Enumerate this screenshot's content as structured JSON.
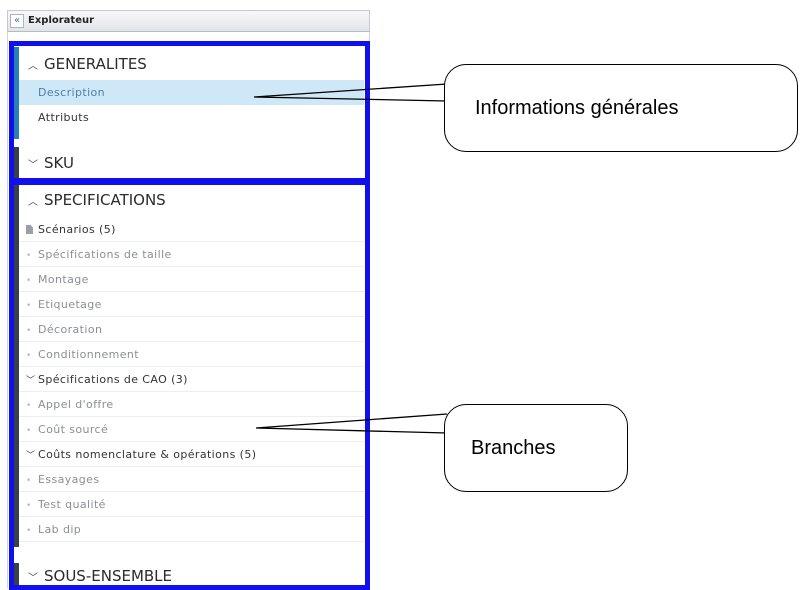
{
  "panel": {
    "title": "Explorateur",
    "collapse_glyph": "«"
  },
  "sections": {
    "generalites": {
      "title": "GENERALITES",
      "expanded": true,
      "accent": "#2a7fb4",
      "items": [
        "Description",
        "Attributs"
      ],
      "selected": "Description"
    },
    "sku": {
      "title": "SKU",
      "expanded": false,
      "accent": "#3a4048"
    },
    "specifications": {
      "title": "SPECIFICATIONS",
      "expanded": true,
      "accent": "#3a4048",
      "items": [
        "Scénarios (5)",
        "Spécifications de taille",
        "Montage",
        "Etiquetage",
        "Décoration",
        "Conditionnement",
        "Spécifications de CAO (3)",
        "Appel d'offre",
        "Coût sourcé",
        "Coûts nomenclature & opérations (5)",
        "Essayages",
        "Test qualité",
        "Lab dip"
      ]
    },
    "sous_ensemble": {
      "title": "SOUS-ENSEMBLE",
      "expanded": false,
      "accent": "#3a4048"
    }
  },
  "callouts": {
    "info": "Informations générales",
    "branches": "Branches"
  },
  "colors": {
    "highlight": "#1010ee",
    "selected_bg": "#cfe8f7",
    "selected_text": "#4a7fb0"
  },
  "icons": {
    "collapse": "double-chevron-left-icon",
    "expand": "chevron-up-icon",
    "collapsed": "chevron-down-icon",
    "scenario": "document-icon"
  }
}
